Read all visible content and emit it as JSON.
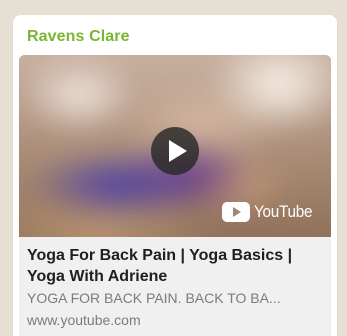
{
  "message": {
    "sender": "Ravens Clare",
    "sender_color": "#7ab530"
  },
  "link_preview": {
    "provider_logo_text": "YouTube",
    "play_icon": "play-icon",
    "title": "Yoga For Back Pain | Yoga Basics | Yoga With Adriene",
    "description": "YOGA FOR BACK PAIN. BACK TO BA...",
    "domain": "www.youtube.com"
  }
}
